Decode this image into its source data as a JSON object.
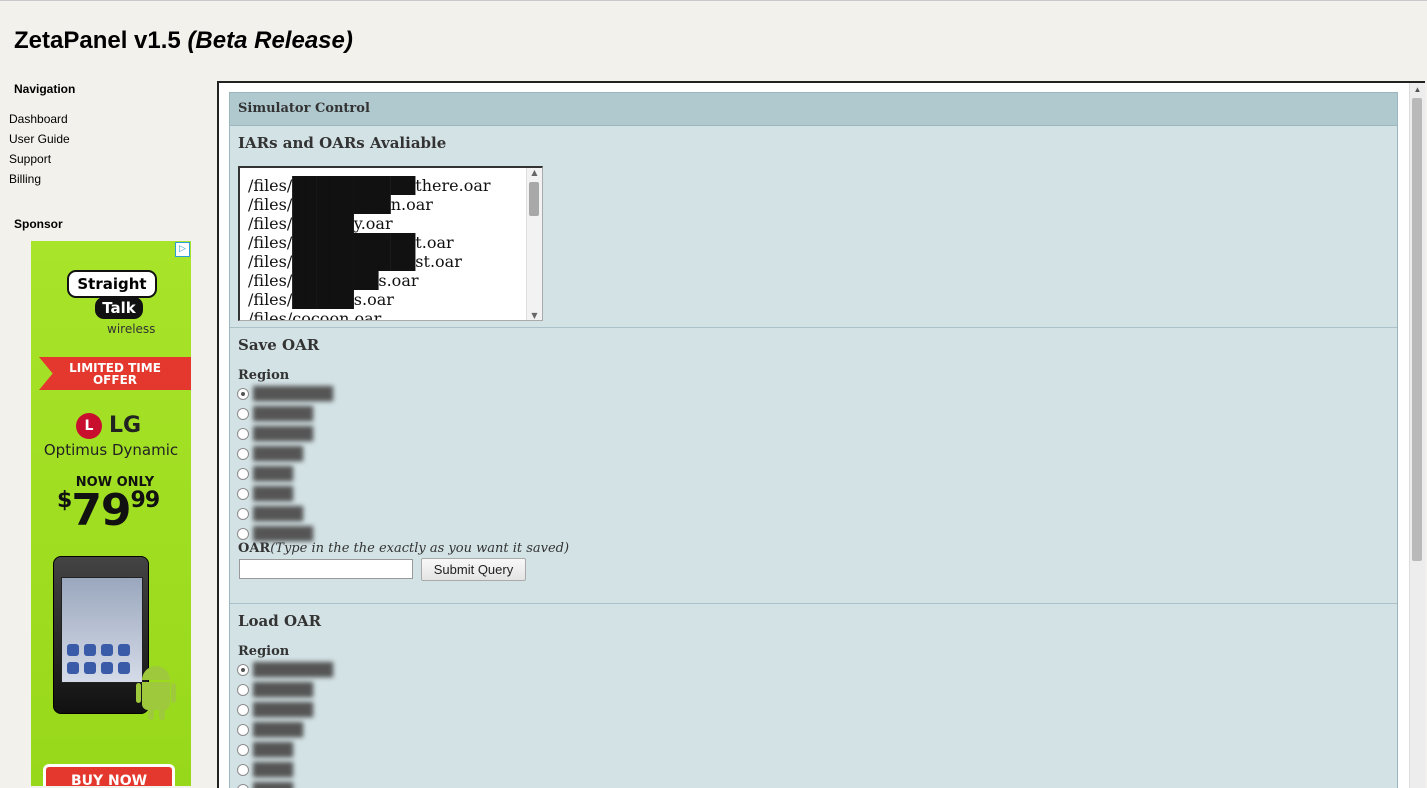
{
  "app": {
    "title": "ZetaPanel v1.5",
    "subtitle": "(Beta Release)"
  },
  "sidebar": {
    "navigation_heading": "Navigation",
    "nav_items": [
      {
        "label": "Dashboard"
      },
      {
        "label": "User Guide"
      },
      {
        "label": "Support"
      },
      {
        "label": "Billing"
      }
    ],
    "sponsor_heading": "Sponsor"
  },
  "ad": {
    "brand_line1": "Straight",
    "brand_line2": "Talk",
    "brand_sub": "wireless",
    "banner_line1": "LIMITED TIME",
    "banner_line2": "OFFER",
    "maker": "LG",
    "model": "Optimus Dynamic",
    "now_only": "NOW ONLY",
    "price": "$7999",
    "price_dollar": "$",
    "price_main": "79",
    "price_cents": "99",
    "cta": "BUY NOW",
    "choices_icon": "adchoices-icon",
    "colors": {
      "background": "#a8e42a",
      "banner": "#e4382e"
    }
  },
  "panel": {
    "header": "Simulator Control",
    "files_section": {
      "title": "IARs and OARs Avaliable",
      "files": [
        "/files/██████████there.oar",
        "/files/████████n.oar",
        "/files/█████y.oar",
        "/files/██████████t.oar",
        "/files/██████████st.oar",
        "/files/███████s.oar",
        "/files/█████s.oar",
        "/files/cocoon.oar"
      ]
    },
    "save_section": {
      "title": "Save OAR",
      "region_label": "Region",
      "regions": [
        {
          "name": "████████",
          "selected": true
        },
        {
          "name": "██████",
          "selected": false
        },
        {
          "name": "██████",
          "selected": false
        },
        {
          "name": "█████",
          "selected": false
        },
        {
          "name": "████",
          "selected": false
        },
        {
          "name": "████",
          "selected": false
        },
        {
          "name": "█████",
          "selected": false
        },
        {
          "name": "██████",
          "selected": false
        }
      ],
      "oar_label": "OAR",
      "oar_hint": "(Type in the the exactly as you want it saved)",
      "oar_value": "",
      "submit_label": "Submit Query"
    },
    "load_section": {
      "title": "Load OAR",
      "region_label": "Region",
      "regions": [
        {
          "name": "████████",
          "selected": true
        },
        {
          "name": "██████",
          "selected": false
        },
        {
          "name": "██████",
          "selected": false
        },
        {
          "name": "█████",
          "selected": false
        },
        {
          "name": "████",
          "selected": false
        },
        {
          "name": "████",
          "selected": false
        },
        {
          "name": "████",
          "selected": false
        }
      ]
    },
    "colors": {
      "card": "#d3e2e5",
      "header": "#afc9ce"
    }
  }
}
